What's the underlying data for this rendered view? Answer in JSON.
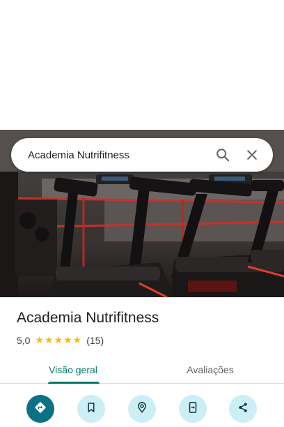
{
  "search": {
    "query": "Academia Nutrifitness"
  },
  "place": {
    "name": "Academia Nutrifitness",
    "rating": "5,0",
    "stars": "★★★★★",
    "review_count": "(15)"
  },
  "tabs": [
    {
      "label": "Visão geral",
      "selected": true
    },
    {
      "label": "Avaliações",
      "selected": false
    }
  ],
  "actions": [
    {
      "icon": "directions-icon"
    },
    {
      "icon": "bookmark-icon"
    },
    {
      "icon": "nearby-icon"
    },
    {
      "icon": "send-to-phone-icon"
    },
    {
      "icon": "share-icon"
    }
  ],
  "colors": {
    "accent": "#00796b",
    "star": "#fbbc04",
    "action_primary": "#0b7285",
    "action_secondary": "#cceef5"
  }
}
